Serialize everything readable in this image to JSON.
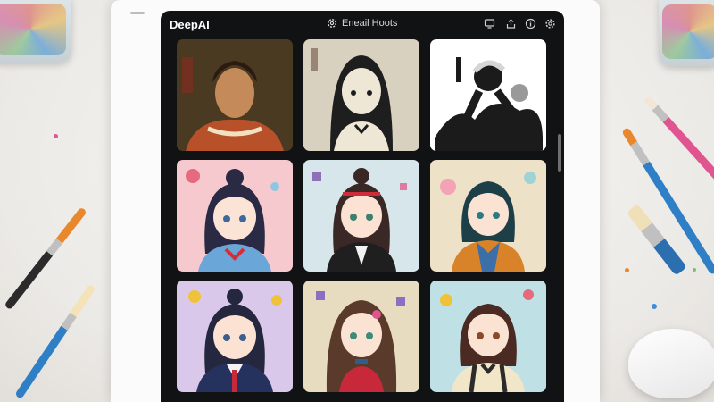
{
  "app": {
    "brand": "DeepAI",
    "title": "Eneail Hoots",
    "title_icon": "gear-icon",
    "toolbar_icons": [
      "monitor-icon",
      "share-icon",
      "info-icon",
      "settings-icon"
    ]
  },
  "gallery": {
    "items": [
      {
        "style": "classical oil portrait",
        "bg": "#4a3a22"
      },
      {
        "style": "ink sketch girl",
        "bg": "#d9d1bf"
      },
      {
        "style": "sumi-e ink figure",
        "bg": "#ffffff"
      },
      {
        "style": "anime girl sailor",
        "bg": "#f6c9cf"
      },
      {
        "style": "anime girl red ribbon",
        "bg": "#d7e6ea"
      },
      {
        "style": "anime girl teal hair",
        "bg": "#ede2c8"
      },
      {
        "style": "anime girl uniform",
        "bg": "#d9c8ea"
      },
      {
        "style": "anime girl long hair",
        "bg": "#e8dcc0"
      },
      {
        "style": "anime girl suspenders",
        "bg": "#bfe1e6"
      }
    ]
  },
  "colors": {
    "window_bg": "#111214",
    "accent_brush_orange": "#e8872c",
    "accent_brush_blue": "#2f7fc6",
    "accent_brush_pink": "#e0558f"
  }
}
